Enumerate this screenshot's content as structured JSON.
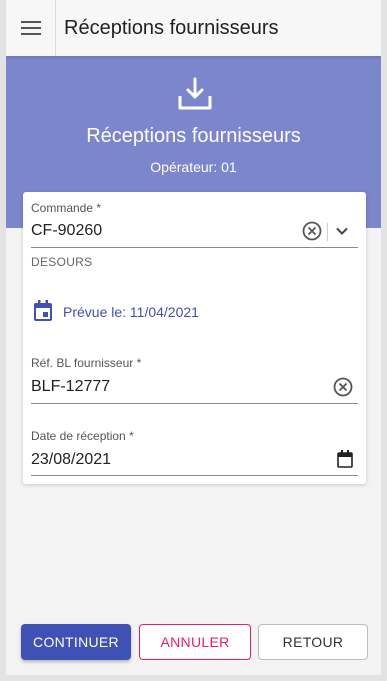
{
  "app": {
    "title": "Réceptions fournisseurs"
  },
  "hero": {
    "title": "Réceptions fournisseurs",
    "subtitle": "Opérateur: 01"
  },
  "form": {
    "order": {
      "label": "Commande *",
      "value": "CF-90260"
    },
    "supplier_name": "DESOURS",
    "planned_date": "Prévue le: 11/04/2021",
    "delivery_ref": {
      "label": "Réf. BL fournisseur *",
      "value": "BLF-12777"
    },
    "reception_date": {
      "label": "Date de réception *",
      "value": "23/08/2021"
    }
  },
  "buttons": {
    "continue": "CONTINUER",
    "cancel": "ANNULER",
    "back": "RETOUR"
  },
  "colors": {
    "primary": "#3f51b5",
    "hero": "#7c86cd",
    "cancel": "#e91e63"
  },
  "icons": [
    "menu-icon",
    "download-icon",
    "clear-icon",
    "chevron-down-icon",
    "event-icon",
    "calendar-icon"
  ]
}
